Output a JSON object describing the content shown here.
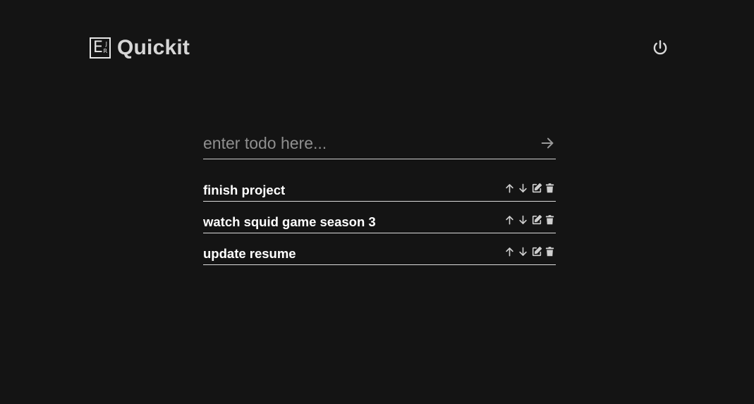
{
  "header": {
    "logo_letter": "E",
    "logo_small_top": "J",
    "logo_small_bottom": "R",
    "app_title": "Quickit",
    "logout_icon": "power-icon"
  },
  "form": {
    "placeholder": "enter todo here...",
    "value": "",
    "submit_icon": "arrow-right-icon"
  },
  "todos": [
    {
      "text": "finish project"
    },
    {
      "text": "watch squid game season 3"
    },
    {
      "text": "update resume"
    }
  ],
  "item_actions": [
    "arrow-up-icon",
    "arrow-down-icon",
    "edit-icon",
    "trash-icon"
  ],
  "colors": {
    "background": "#141414",
    "text": "#ffffff",
    "muted": "#8f8f8f",
    "icon": "#cfcfcf"
  }
}
